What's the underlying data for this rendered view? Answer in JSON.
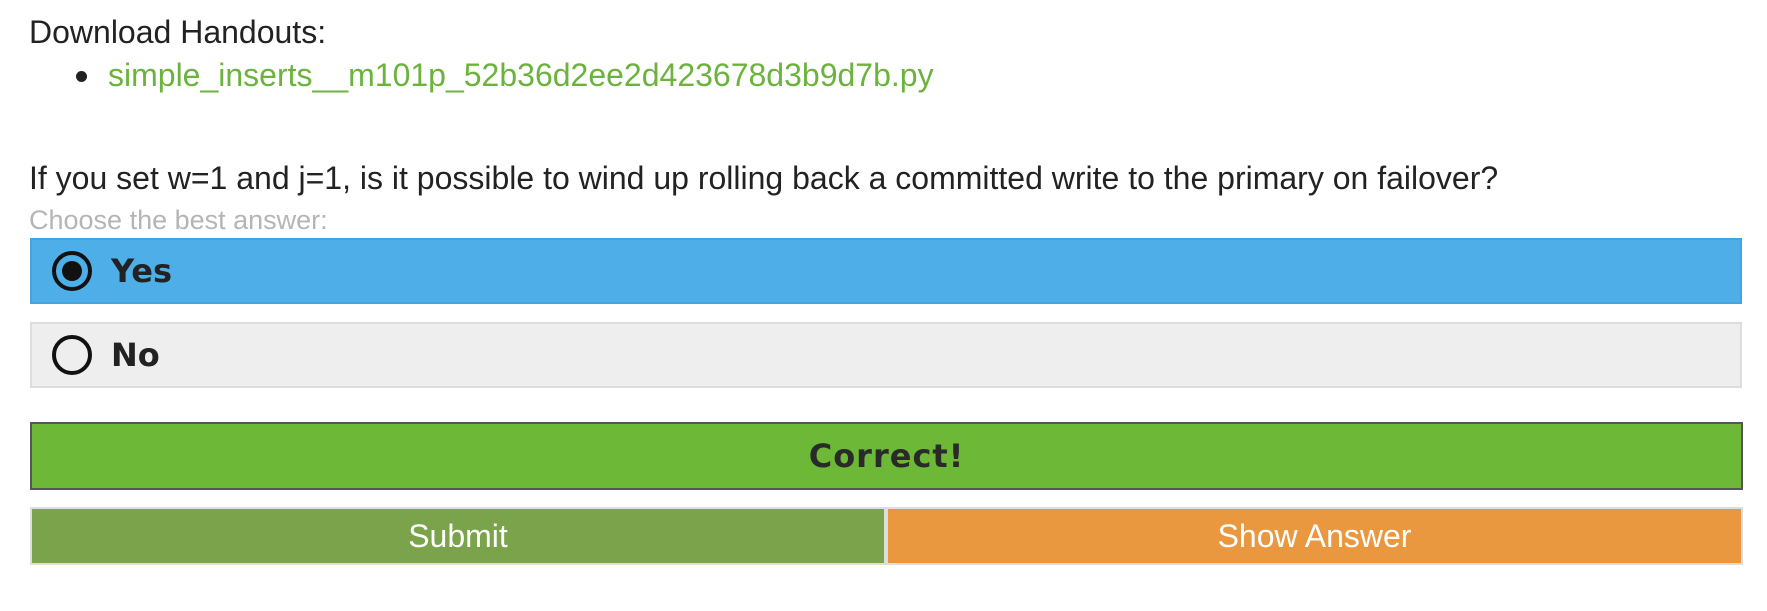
{
  "handouts": {
    "title": "Download Handouts:",
    "files": [
      "simple_inserts__m101p_52b36d2ee2d423678d3b9d7b.py"
    ]
  },
  "question": {
    "text": "If you set w=1 and j=1, is it possible to wind up rolling back a committed write to the primary on failover?",
    "instruction": "Choose the best answer:",
    "options": [
      {
        "label": "Yes",
        "selected": true
      },
      {
        "label": "No",
        "selected": false
      }
    ]
  },
  "result": {
    "text": "Correct!"
  },
  "buttons": {
    "submit_label": "Submit",
    "show_answer_label": "Show Answer"
  },
  "colors": {
    "link": "#6cb33e",
    "selected_option": "#4eaee8",
    "unselected_option": "#eeeeee",
    "correct_banner": "#6db937",
    "submit_button": "#7aa34b",
    "show_answer_button": "#e9983f",
    "instruction_text": "#b5b5b5"
  }
}
